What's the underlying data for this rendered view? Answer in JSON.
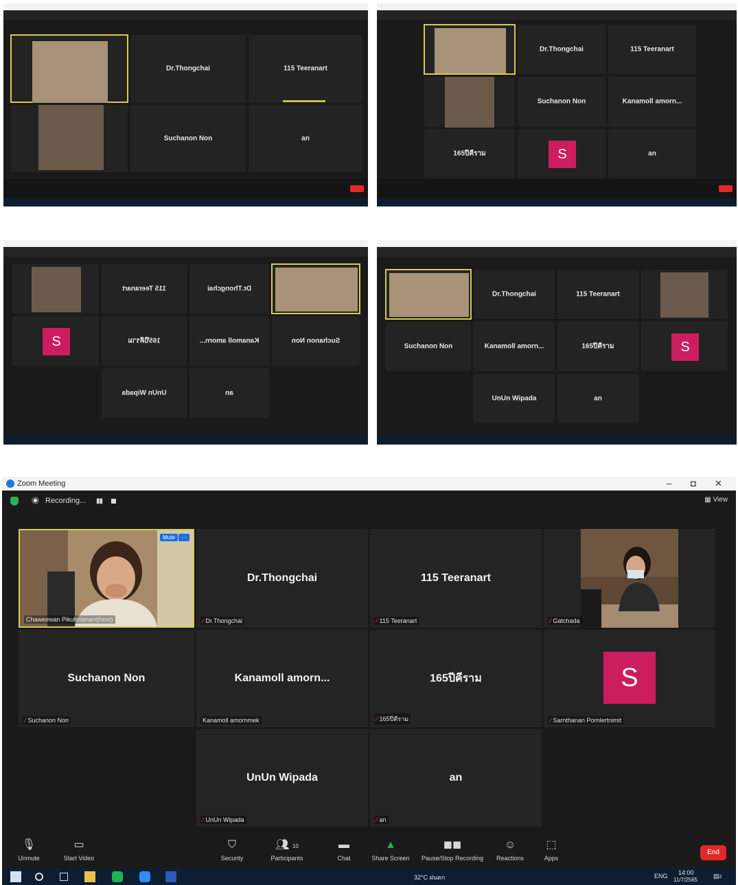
{
  "thumbnails": [
    {
      "tiles": [
        "Dr.Thongchai",
        "115 Teeranart",
        "Suchanon Non",
        "an"
      ]
    },
    {
      "tiles": [
        "Dr.Thongchai",
        "115 Teeranart",
        "Suchanon Non",
        "Kanamoll amorn...",
        "165ปีคีราม",
        "an"
      ]
    },
    {
      "tiles": [
        "115 Teeranart",
        "Dr.Thongchai",
        "165ปีคีราม",
        "Kanamoll amorn...",
        "Suchanon Non",
        "UnUn Wipada",
        "an"
      ],
      "avatar": "S",
      "mirrored": true
    },
    {
      "tiles": [
        "Dr.Thongchai",
        "115 Teeranart",
        "Suchanon Non",
        "Kanamoll amorn...",
        "165ปีคีราม",
        "UnUn Wipada",
        "an"
      ],
      "avatar": "S"
    }
  ],
  "window": {
    "title": "Zoom Meeting",
    "controls": [
      "–",
      "◘",
      "✕"
    ],
    "recording_label": "Recording...",
    "view_label": "View"
  },
  "participants": [
    {
      "display": "",
      "label": "Chaweewan Pikulsrianant(host)",
      "type": "video",
      "active": true,
      "mute_label": "Mute",
      "more_label": "···"
    },
    {
      "display": "Dr.Thongchai",
      "label": "Dr.Thongchai",
      "type": "name"
    },
    {
      "display": "115 Teeranart",
      "label": "115 Teeranart",
      "type": "name"
    },
    {
      "display": "",
      "label": "Gatchada",
      "type": "video"
    },
    {
      "display": "Suchanon Non",
      "label": "Suchanon Non",
      "type": "name"
    },
    {
      "display": "Kanamoll  amorn...",
      "label": "Kanamoll amornmek",
      "type": "name"
    },
    {
      "display": "165ปีคีราม",
      "label": "165ปีคีราม",
      "type": "name"
    },
    {
      "display": "S",
      "label": "Sarnthanan Pornlertnimit",
      "type": "avatar"
    },
    {
      "display": "UnUn Wipada",
      "label": "UnUn Wipada",
      "type": "name"
    },
    {
      "display": "an",
      "label": "an",
      "type": "name"
    }
  ],
  "toolbar": {
    "unmute": "Unmute",
    "start_video": "Start Video",
    "security": "Security",
    "participants": "Participants",
    "participants_count": "10",
    "chat": "Chat",
    "share_screen": "Share Screen",
    "pause_stop_recording": "Pause/Stop Recording",
    "reactions": "Reactions",
    "apps": "Apps",
    "end": "End"
  },
  "taskbar": {
    "weather": "32°C ฝนตก",
    "language": "ENG",
    "time": "14:00",
    "date": "11/7/2565",
    "notification_count": "2"
  },
  "colors": {
    "avatar": "#cc1d5e",
    "active_speaker_border": "#d6cb55",
    "end_button": "#e02828",
    "accent_blue": "#1a6fe3"
  }
}
